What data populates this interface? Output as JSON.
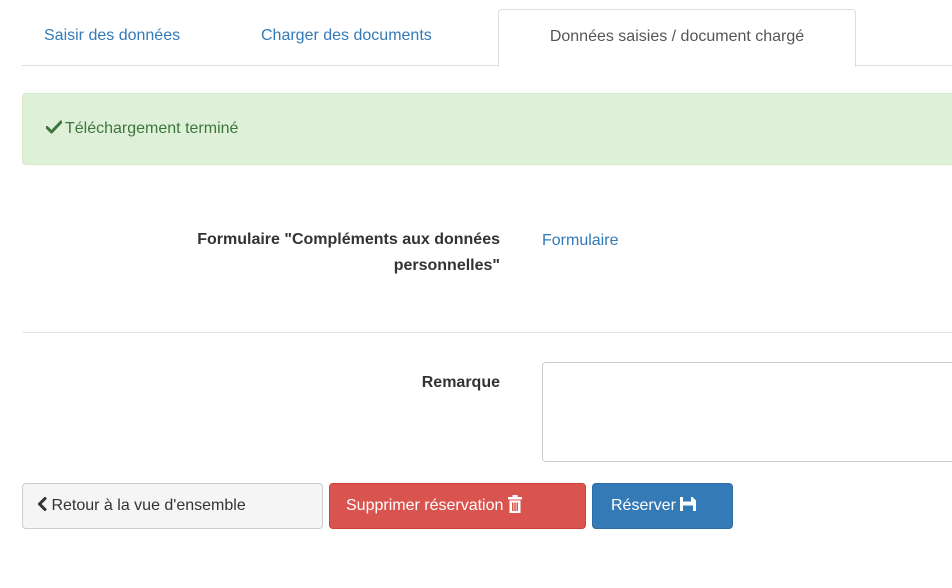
{
  "tabs": [
    {
      "label": "Saisir des données",
      "active": false
    },
    {
      "label": "Charger des documents",
      "active": false
    },
    {
      "label": "Données saisies / document chargé",
      "active": true
    }
  ],
  "alert": {
    "icon": "checkmark-icon",
    "message": "Téléchargement terminé",
    "color": "#3c763d",
    "background": "#dff0d8"
  },
  "form": {
    "complement_label": "Formulaire \"Compléments aux données personnelles\"",
    "complement_link": "Formulaire",
    "remark_label": "Remarque",
    "remark_value": ""
  },
  "buttons": {
    "back_label": "Retour à la vue d'ensemble",
    "back_icon": "chevron-left-icon",
    "delete_label": "Supprimer réservation",
    "delete_icon": "trash-icon",
    "delete_color": "#d9534f",
    "save_label": "Réserver",
    "save_icon": "floppy-disk-icon",
    "save_color": "#337ab7"
  }
}
